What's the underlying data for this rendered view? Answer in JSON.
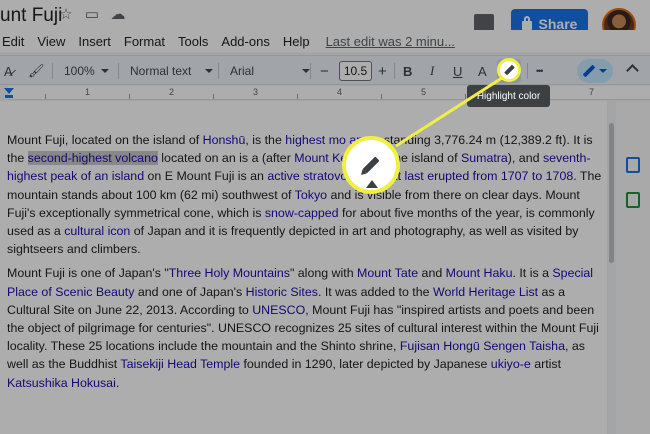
{
  "title_bar": {
    "doc_title": "unt Fuji",
    "star_icon": "star-icon",
    "move_icon": "folder-move-icon",
    "cloud_icon": "cloud-status-icon",
    "share_label": "Share",
    "avatar_icon": "user-avatar"
  },
  "menu": {
    "items": [
      "Edit",
      "View",
      "Insert",
      "Format",
      "Tools",
      "Add-ons",
      "Help"
    ],
    "last_edit": "Last edit was 2 minu..."
  },
  "toolbar": {
    "zoom": "100%",
    "style": "Normal text",
    "font": "Arial",
    "minus": "−",
    "font_size": "10.5",
    "plus": "+",
    "bold": "B",
    "italic": "I",
    "underline": "U",
    "text_color": "A",
    "more": "•••"
  },
  "tooltip": "Highlight color",
  "ruler": {
    "numbers": [
      "1",
      "2",
      "3",
      "4",
      "5",
      "6",
      "7"
    ]
  },
  "document": {
    "p1": [
      {
        "t": "Mount Fuji, located on the island of "
      },
      {
        "t": "Honshū",
        "link": true
      },
      {
        "t": ", is the "
      },
      {
        "t": "highest mo",
        "link": true
      },
      {
        "t": "              "
      },
      {
        "t": "apan",
        "link": true
      },
      {
        "t": ", standing 3,776.24 m (12,389.2 ft). It is the "
      },
      {
        "t": "second-highest volcano",
        "link": true,
        "sel": true
      },
      {
        "t": " located on an is"
      },
      {
        "t": "               "
      },
      {
        "t": "a (after "
      },
      {
        "t": "Mount Kerinci",
        "link": true
      },
      {
        "t": " on the island of "
      },
      {
        "t": "Sumatra",
        "link": true
      },
      {
        "t": "), and "
      },
      {
        "t": "seventh-highest peak of an island",
        "link": true
      },
      {
        "t": " on E"
      },
      {
        "t": "          "
      },
      {
        "t": " Mount Fuji is an "
      },
      {
        "t": "active stratovolcano",
        "link": true
      },
      {
        "t": " that "
      },
      {
        "t": "last erupted from 1707 to 1708",
        "link": true
      },
      {
        "t": ". The mountain stands about 100 km (62 mi) southwest of "
      },
      {
        "t": "Tokyo",
        "link": true
      },
      {
        "t": " and is visible from there on clear days. Mount Fuji's exceptionally symmetrical cone, which is "
      },
      {
        "t": "snow-capped",
        "link": true
      },
      {
        "t": " for about five months of the year, is commonly used as a "
      },
      {
        "t": "cultural icon",
        "link": true
      },
      {
        "t": " of Japan and it is frequently depicted in art and photography, as well as visited by sightseers and climbers."
      }
    ],
    "p2": [
      {
        "t": "Mount Fuji is one of Japan's \""
      },
      {
        "t": "Three Holy Mountains",
        "link": true
      },
      {
        "t": "\" along with "
      },
      {
        "t": "Mount Tate",
        "link": true
      },
      {
        "t": " and "
      },
      {
        "t": "Mount Haku",
        "link": true
      },
      {
        "t": ". It is a "
      },
      {
        "t": "Special Place of Scenic Beauty",
        "link": true
      },
      {
        "t": " and one of Japan's "
      },
      {
        "t": "Historic Sites",
        "link": true
      },
      {
        "t": ". It was added to the "
      },
      {
        "t": "World Heritage List",
        "link": true
      },
      {
        "t": " as a Cultural Site on June 22, 2013. According to "
      },
      {
        "t": "UNESCO",
        "link": true
      },
      {
        "t": ", Mount Fuji has \"inspired artists and poets and been the object of pilgrimage for centuries\". UNESCO recognizes 25 sites of cultural interest within the Mount Fuji locality. These 25 locations include the mountain and the Shinto shrine, "
      },
      {
        "t": "Fujisan Hongū Sengen Taisha",
        "link": true
      },
      {
        "t": ", as well as the Buddhist "
      },
      {
        "t": "Taisekiji Head Temple",
        "link": true
      },
      {
        "t": " founded in 1290, later depicted by Japanese "
      },
      {
        "t": "ukiyo-e",
        "link": true
      },
      {
        "t": " artist "
      },
      {
        "t": "Katsushika Hokusai",
        "link": true
      },
      {
        "t": "."
      }
    ]
  },
  "colors": {
    "share_blue": "#1a73e8",
    "callout_yellow": "#f1ef43",
    "link": "#1a0dab"
  }
}
